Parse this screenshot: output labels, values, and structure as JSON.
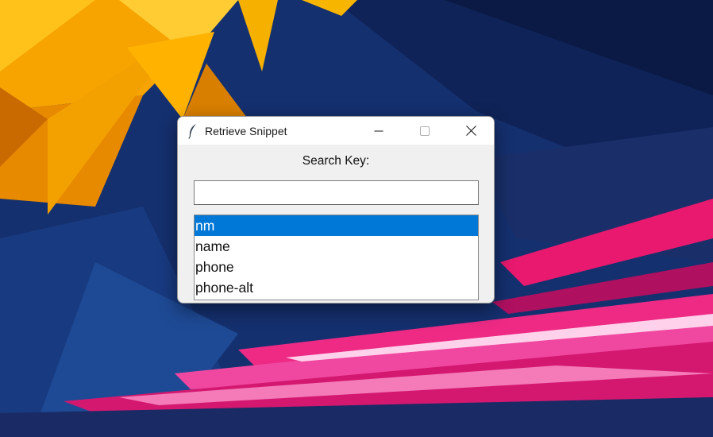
{
  "window": {
    "title": "Retrieve Snippet",
    "app_icon": "feather-icon",
    "controls": {
      "minimize_icon": "minimize-icon",
      "maximize_icon": "maximize-icon",
      "close_icon": "close-icon"
    }
  },
  "form": {
    "search_label": "Search Key:",
    "search_value": "",
    "search_placeholder": ""
  },
  "results": {
    "items": [
      {
        "label": "nm",
        "selected": true
      },
      {
        "label": "name",
        "selected": false
      },
      {
        "label": "phone",
        "selected": false
      },
      {
        "label": "phone-alt",
        "selected": false
      }
    ]
  },
  "colors": {
    "selection": "#0078d7",
    "window_bg": "#f0f0f0",
    "titlebar_bg": "#ffffff"
  }
}
